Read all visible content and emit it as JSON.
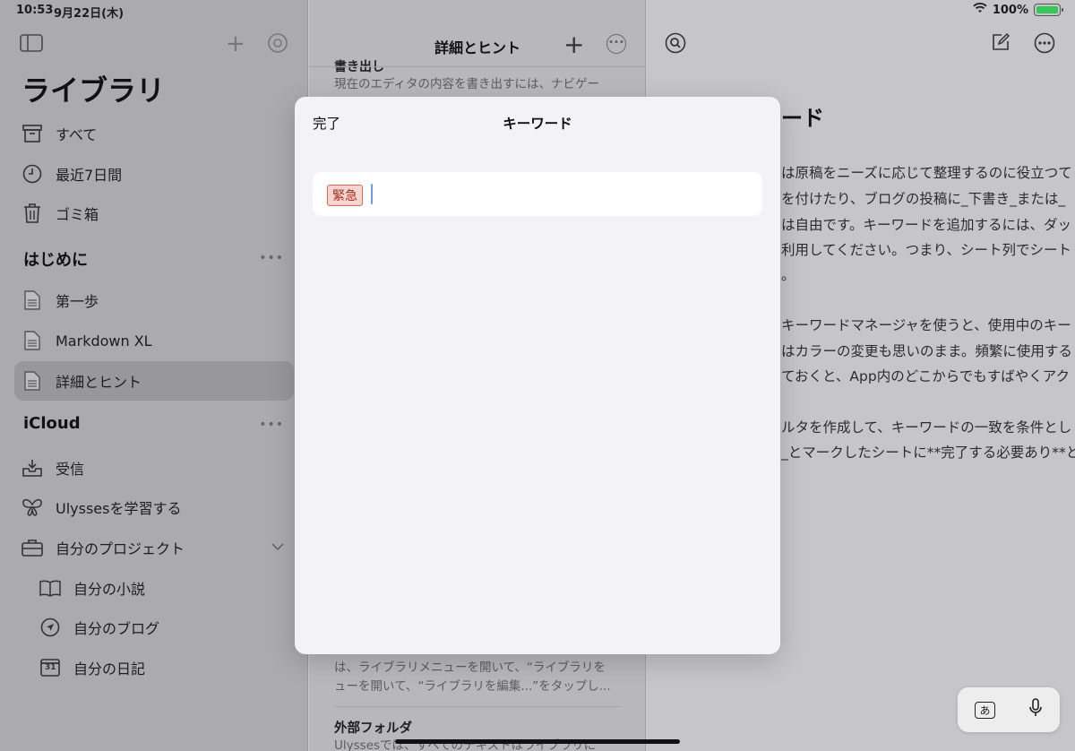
{
  "status": {
    "time": "10:53",
    "date": "9月22日(木)",
    "battery": "100%"
  },
  "sidebar": {
    "title": "ライブラリ",
    "top_items": [
      {
        "label": "すべて",
        "icon": "archive-icon"
      },
      {
        "label": "最近7日間",
        "icon": "clock-icon"
      },
      {
        "label": "ゴミ箱",
        "icon": "trash-icon"
      }
    ],
    "section1": "はじめに",
    "section1_items": [
      {
        "label": "第一歩",
        "icon": "document-icon"
      },
      {
        "label": "Markdown XL",
        "icon": "document-icon"
      },
      {
        "label": "詳細とヒント",
        "icon": "document-icon"
      }
    ],
    "section2": "iCloud",
    "section2_items": [
      {
        "label": "受信",
        "icon": "inbox-icon"
      },
      {
        "label": "Ulyssesを学習する",
        "icon": "butterfly-icon"
      },
      {
        "label": "自分のプロジェクト",
        "icon": "briefcase-icon"
      }
    ],
    "project_items": [
      {
        "label": "自分の小説",
        "icon": "book-icon"
      },
      {
        "label": "自分のブログ",
        "icon": "navigation-icon"
      },
      {
        "label": "自分の日記",
        "icon": "calendar-icon",
        "day": "31"
      }
    ]
  },
  "middle": {
    "title": "詳細とヒント",
    "cut_title": "書き出し",
    "top_snippet": "現在のエディタの内容を書き出すには、ナビゲー",
    "bottom_snippet_1": "は、ライブラリメニューを開いて、“ライブラリを",
    "bottom_snippet_2": "ューを開いて、“ライブラリを編集...”をタップし...",
    "item_title": "外部フォルダ",
    "item_snippet": "Ulyssesでは、すべてのテキストはライブラリに"
  },
  "editor": {
    "heading": "ード",
    "lines": [
      "は原稿をニーズに応じて整理するのに役立つて",
      "を付けたり、ブログの投稿に_下書き_または_",
      "は自由です。キーワードを追加するには、ダッ",
      "利用してください。つまり、シート列でシート",
      "。",
      "キーワードマネージャを使うと、使用中のキー",
      "はカラーの変更も思いのまま。頻繁に使用する",
      "ておくと、App内のどこからでもすばやくアク",
      "ルタを作成して、キーワードの一致を条件とし",
      "_とマークしたシートに**完了する必要あり**と"
    ]
  },
  "modal": {
    "done_label": "完了",
    "title": "キーワード",
    "keyword": "緊急"
  },
  "keyboard": {
    "kana": "あ"
  }
}
